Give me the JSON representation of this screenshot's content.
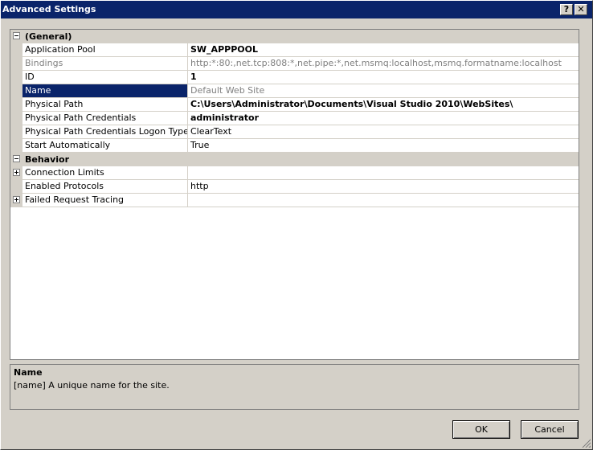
{
  "window": {
    "title": "Advanced Settings",
    "help_glyph": "?",
    "close_glyph": "✕"
  },
  "categories": {
    "general": {
      "label": "(General)",
      "expander": "minus"
    },
    "behavior": {
      "label": "Behavior",
      "expander": "minus"
    }
  },
  "properties": {
    "application_pool": {
      "name": "Application Pool",
      "value": "SW_APPPOOL"
    },
    "bindings": {
      "name": "Bindings",
      "value": "http:*:80:,net.tcp:808:*,net.pipe:*,net.msmq:localhost,msmq.formatname:localhost"
    },
    "id": {
      "name": "ID",
      "value": "1"
    },
    "name": {
      "name": "Name",
      "value": "Default Web Site"
    },
    "physical_path": {
      "name": "Physical Path",
      "value": "C:\\Users\\Administrator\\Documents\\Visual Studio 2010\\WebSites\\"
    },
    "physical_path_credentials": {
      "name": "Physical Path Credentials",
      "value": "administrator"
    },
    "logon_type": {
      "name": "Physical Path Credentials Logon Type",
      "value": "ClearText"
    },
    "start_automatically": {
      "name": "Start Automatically",
      "value": "True"
    },
    "connection_limits": {
      "name": "Connection Limits",
      "value": "",
      "expander": "plus"
    },
    "enabled_protocols": {
      "name": "Enabled Protocols",
      "value": "http"
    },
    "failed_request_tracing": {
      "name": "Failed Request Tracing",
      "value": "",
      "expander": "plus"
    }
  },
  "description": {
    "title": "Name",
    "text": "[name] A unique name for the site."
  },
  "buttons": {
    "ok": "OK",
    "cancel": "Cancel"
  },
  "colors": {
    "titlebar": "#0a246a",
    "selection": "#0a246a",
    "face": "#d4d0c8"
  }
}
